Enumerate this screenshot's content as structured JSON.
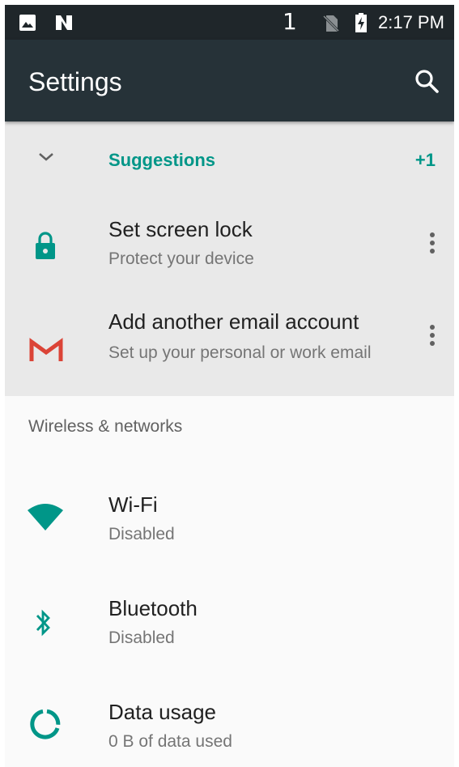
{
  "status_bar": {
    "sim_number": "1",
    "time": "2:17 PM",
    "icons": [
      "image-icon",
      "n-icon",
      "no-sim-icon",
      "battery-charging-icon"
    ]
  },
  "app_bar": {
    "title": "Settings",
    "search_icon": "search-icon"
  },
  "suggestions": {
    "header": "Suggestions",
    "count": "+1",
    "items": [
      {
        "title": "Set screen lock",
        "subtitle": "Protect your device",
        "icon": "lock-icon"
      },
      {
        "title": "Add another email account",
        "subtitle": "Set up your personal or work email",
        "icon": "gmail-icon"
      }
    ]
  },
  "wireless_section": {
    "header": "Wireless & networks",
    "rows": [
      {
        "title": "Wi-Fi",
        "subtitle": "Disabled",
        "icon": "wifi-icon"
      },
      {
        "title": "Bluetooth",
        "subtitle": "Disabled",
        "icon": "bluetooth-icon"
      },
      {
        "title": "Data usage",
        "subtitle": "0 B of data used",
        "icon": "data-usage-icon"
      }
    ]
  },
  "colors": {
    "accent": "#009688",
    "appbar": "#263238",
    "statusbar": "#1f262a",
    "suggestions_bg": "#e9e9e9",
    "gmail_red": "#db4437"
  }
}
